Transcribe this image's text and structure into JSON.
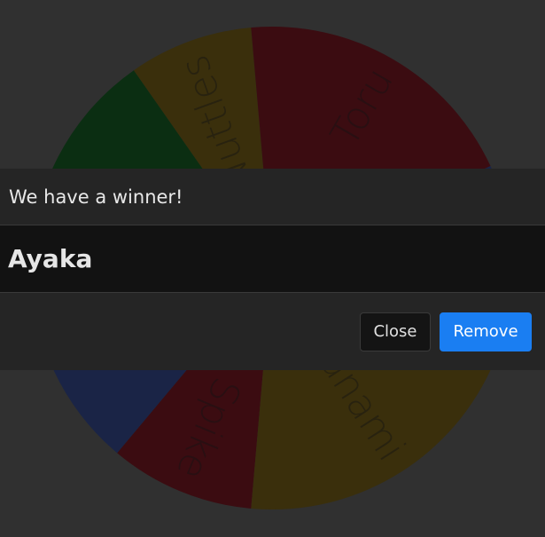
{
  "wheel": {
    "segments": [
      {
        "label": "Spike",
        "color": "#3b0c11"
      },
      {
        "label": "",
        "color": "#1a2446"
      },
      {
        "label": "",
        "color": "#0b2e12"
      },
      {
        "label": "Nuttles",
        "color": "#3a2f0c"
      },
      {
        "label": "Toru",
        "color": "#3b0c11"
      },
      {
        "label": "",
        "color": "#1a2446"
      },
      {
        "label": "Kanami",
        "color": "#3a2f0c"
      }
    ]
  },
  "dialog": {
    "title": "We have a winner!",
    "winner": "Ayaka",
    "close_label": "Close",
    "remove_label": "Remove"
  },
  "colors": {
    "background": "#303030",
    "primary": "#1a7ef2"
  }
}
